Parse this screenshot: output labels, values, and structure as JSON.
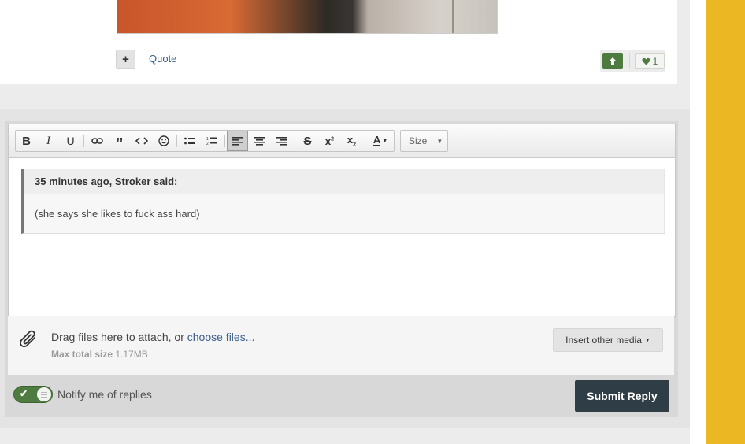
{
  "post": {
    "actions": {
      "plus_label": "+",
      "quote_label": "Quote"
    },
    "reactions": {
      "like_count": "1"
    }
  },
  "editor": {
    "toolbar": {
      "size_label": "Size",
      "buttons": [
        {
          "name": "bold-button",
          "glyph": "B"
        },
        {
          "name": "italic-button",
          "glyph": "I"
        },
        {
          "name": "underline-button",
          "glyph": "U"
        }
      ]
    },
    "quote": {
      "attribution": "35 minutes ago, Stroker said:",
      "text": "(she says she likes to fuck ass hard)"
    }
  },
  "attachments": {
    "prompt": "Drag files here to attach, or ",
    "choose_link": "choose files...",
    "max_label": "Max total size",
    "max_value": "1.17MB",
    "insert_media_label": "Insert other media"
  },
  "footer": {
    "notify_label": "Notify me of replies",
    "submit_label": "Submit Reply"
  },
  "colors": {
    "accent_green": "#4e7b3f",
    "submit_bg": "#2f3e46",
    "side_stripe": "#ebb723",
    "link": "#3b5f8a"
  }
}
